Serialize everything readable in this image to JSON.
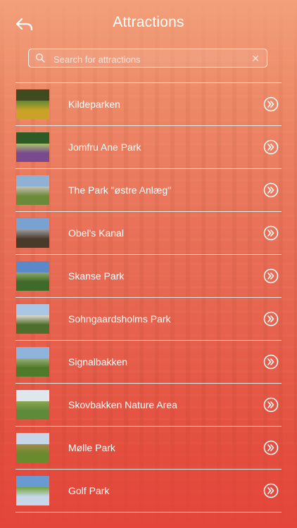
{
  "header": {
    "title": "Attractions",
    "back_icon": "back-arrow-icon"
  },
  "search": {
    "placeholder": "Search for attractions",
    "value": "",
    "search_icon": "magnifier-icon",
    "clear_icon": "clear-x-icon"
  },
  "list": {
    "items": [
      {
        "label": "Kildeparken",
        "thumb": [
          "#3f4a1e",
          "#c9a227",
          "#5f8a2e"
        ]
      },
      {
        "label": "Jomfru Ane Park",
        "thumb": [
          "#2e5a25",
          "#7a4a8e",
          "#a9c46a"
        ]
      },
      {
        "label": "The Park \"østre Anlæg\"",
        "thumb": [
          "#8fb2d4",
          "#6b8a3a",
          "#c7c0b0"
        ]
      },
      {
        "label": "Obel's Kanal",
        "thumb": [
          "#7aa2d0",
          "#4a3a2a",
          "#9a9aa0"
        ]
      },
      {
        "label": "Skanse Park",
        "thumb": [
          "#5a88c8",
          "#3e6a2a",
          "#8fa96a"
        ]
      },
      {
        "label": "Sohngaardsholms Park",
        "thumb": [
          "#a9c6e4",
          "#4e6e2c",
          "#ddd8cc"
        ]
      },
      {
        "label": "Signalbakken",
        "thumb": [
          "#8fb4dc",
          "#4f7a2a",
          "#9ab07a"
        ]
      },
      {
        "label": "Skovbakken Nature Area",
        "thumb": [
          "#dfe6ee",
          "#5e8a3a",
          "#8aa64e"
        ]
      },
      {
        "label": "Mølle Park",
        "thumb": [
          "#c6d6e6",
          "#6a8a2e",
          "#a48a4a"
        ]
      },
      {
        "label": "Golf Park",
        "thumb": [
          "#6a9ad2",
          "#c7d7e8",
          "#6fa23a"
        ]
      }
    ],
    "chevron_icon": "chevron-circle-right-icon"
  }
}
